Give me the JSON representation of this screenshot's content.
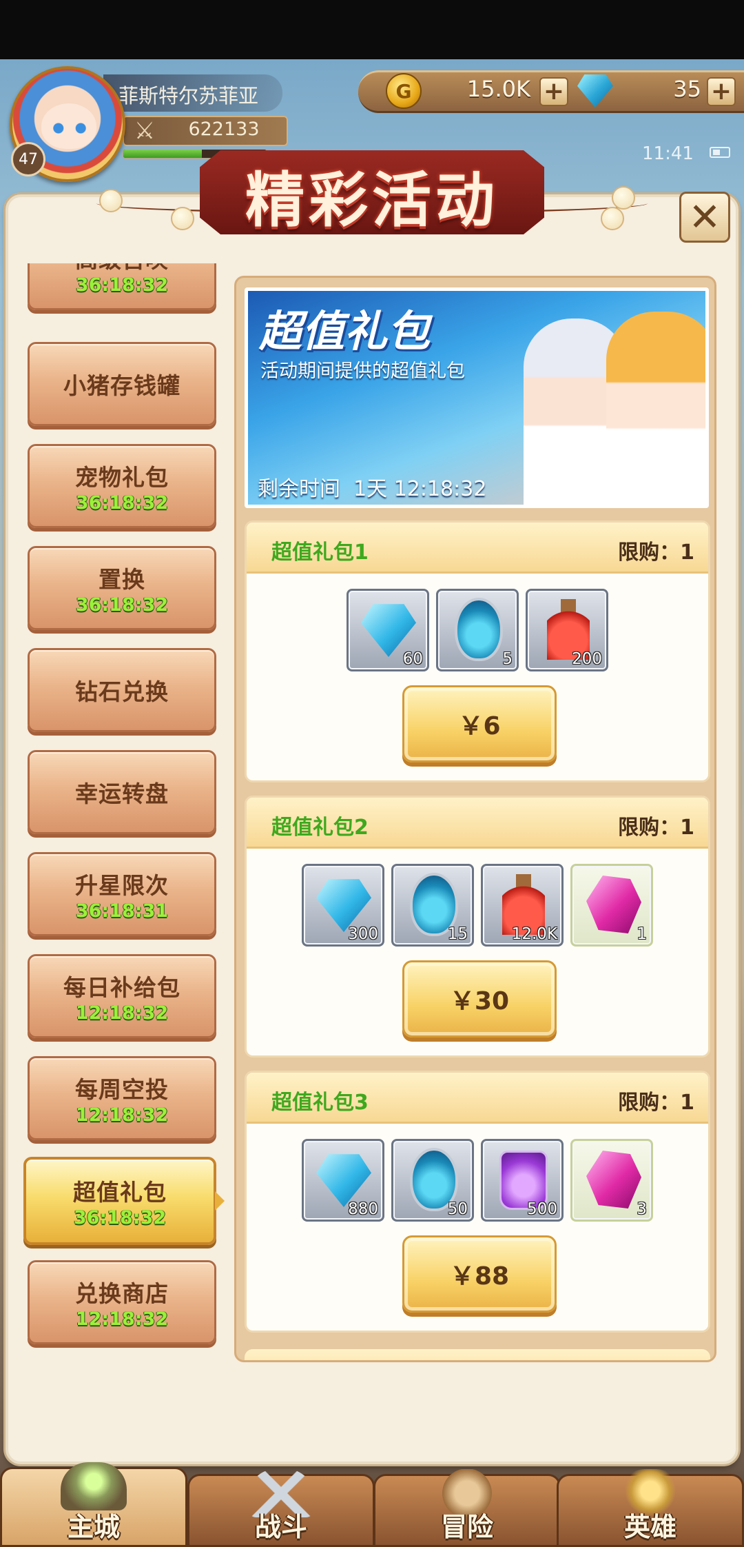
{
  "player": {
    "name": "菲斯特尔苏菲亚",
    "power": "622133",
    "level": "47",
    "exp_fraction": 0.55
  },
  "currency": {
    "gold": "15.0K",
    "gold_symbol": "G",
    "gems": "35",
    "plus": "+"
  },
  "status": {
    "time": "11:41"
  },
  "title": "精彩活动",
  "close_label": "✕",
  "sidebar": {
    "items": [
      {
        "label": "高级召唤",
        "timer": "36:18:32"
      },
      {
        "label": "小猪存钱罐",
        "timer": ""
      },
      {
        "label": "宠物礼包",
        "timer": "36:18:32"
      },
      {
        "label": "置换",
        "timer": "36:18:32"
      },
      {
        "label": "钻石兑换",
        "timer": ""
      },
      {
        "label": "幸运转盘",
        "timer": ""
      },
      {
        "label": "升星限次",
        "timer": "36:18:31"
      },
      {
        "label": "每日补给包",
        "timer": "12:18:32"
      },
      {
        "label": "每周空投",
        "timer": "12:18:32"
      },
      {
        "label": "超值礼包",
        "timer": "36:18:32",
        "active": true
      },
      {
        "label": "兑换商店",
        "timer": "12:18:32"
      }
    ]
  },
  "banner": {
    "title": "超值礼包",
    "subtitle": "活动期间提供的超值礼包",
    "remaining_label": "剩余时间",
    "remaining_value": "1天 12:18:32"
  },
  "packs": [
    {
      "name": "超值礼包1",
      "limit": "限购：1",
      "price": "￥6",
      "items": [
        {
          "icon": "diamond",
          "count": "60"
        },
        {
          "icon": "egg",
          "count": "5"
        },
        {
          "icon": "potion",
          "count": "200"
        }
      ]
    },
    {
      "name": "超值礼包2",
      "limit": "限购：1",
      "price": "￥30",
      "items": [
        {
          "icon": "diamond",
          "count": "300"
        },
        {
          "icon": "egg",
          "count": "15"
        },
        {
          "icon": "potion",
          "count": "12.0K"
        },
        {
          "icon": "gem",
          "count": "1"
        }
      ]
    },
    {
      "name": "超值礼包3",
      "limit": "限购：1",
      "price": "￥88",
      "items": [
        {
          "icon": "diamond",
          "count": "880"
        },
        {
          "icon": "egg",
          "count": "50"
        },
        {
          "icon": "purple-jar",
          "count": "500"
        },
        {
          "icon": "gem",
          "count": "3"
        }
      ]
    }
  ],
  "nav": {
    "tabs": [
      "主城",
      "战斗",
      "冒险",
      "英雄"
    ]
  }
}
